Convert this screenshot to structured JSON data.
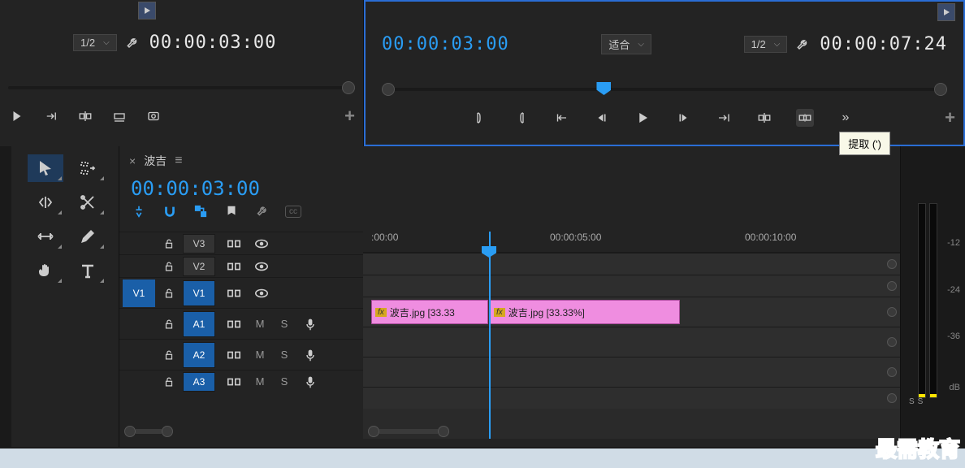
{
  "source_monitor": {
    "zoom": "1/2",
    "timecode": "00:00:03:00"
  },
  "program_monitor": {
    "timecode_in": "00:00:03:00",
    "fit_label": "适合",
    "zoom": "1/2",
    "timecode_out": "00:00:07:24",
    "tooltip": "提取 (')"
  },
  "sequence": {
    "tab_name": "波吉",
    "timecode": "00:00:03:00",
    "ruler": [
      ":00:00",
      "00:00:05:00",
      "00:00:10:00"
    ],
    "tracks": {
      "video": [
        "V3",
        "V2",
        "V1"
      ],
      "source_v": "V1",
      "audio": [
        "A1",
        "A2",
        "A3"
      ]
    },
    "clips": [
      {
        "label": "波吉.jpg [33.33"
      },
      {
        "label": "波吉.jpg [33.33%]"
      }
    ],
    "mute": "M",
    "solo": "S"
  },
  "meters": {
    "ticks": [
      "-12",
      "-24",
      "-36",
      "dB"
    ],
    "solo": "S"
  },
  "watermark": "最需教育"
}
